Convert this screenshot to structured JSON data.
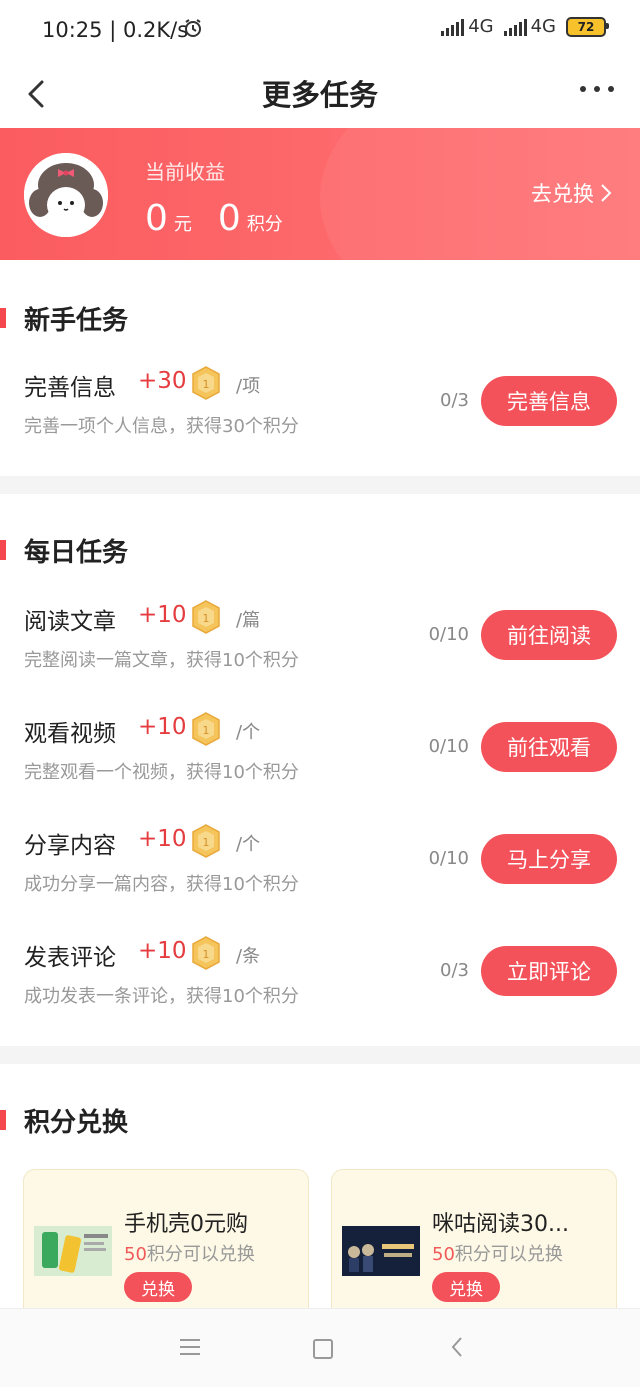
{
  "status_bar": {
    "time": "10:25",
    "speed": "| 0.2K/s",
    "network1": "4G",
    "network2": "4G",
    "battery": "72"
  },
  "header": {
    "title": "更多任务"
  },
  "earnings": {
    "label": "当前收益",
    "yuan_value": "0",
    "yuan_unit": "元",
    "points_value": "0",
    "points_unit": "积分",
    "exchange_link": "去兑换"
  },
  "newbie": {
    "title": "新手任务",
    "tasks": [
      {
        "name": "完善信息",
        "points": "+30",
        "unit": "/项",
        "desc": "完善一项个人信息，获得30个积分",
        "progress": "0/3",
        "button": "完善信息"
      }
    ]
  },
  "daily": {
    "title": "每日任务",
    "tasks": [
      {
        "name": "阅读文章",
        "points": "+10",
        "unit": "/篇",
        "desc": "完整阅读一篇文章，获得10个积分",
        "progress": "0/10",
        "button": "前往阅读"
      },
      {
        "name": "观看视频",
        "points": "+10",
        "unit": "/个",
        "desc": "完整观看一个视频，获得10个积分",
        "progress": "0/10",
        "button": "前往观看"
      },
      {
        "name": "分享内容",
        "points": "+10",
        "unit": "/个",
        "desc": "成功分享一篇内容，获得10个积分",
        "progress": "0/10",
        "button": "马上分享"
      },
      {
        "name": "发表评论",
        "points": "+10",
        "unit": "/条",
        "desc": "成功发表一条评论，获得10个积分",
        "progress": "0/3",
        "button": "立即评论"
      }
    ]
  },
  "exchange": {
    "title": "积分兑换",
    "items": [
      {
        "title": "手机壳0元购",
        "points": "50",
        "sub_suffix": "积分可以兑换",
        "button": "兑换"
      },
      {
        "title": "咪咕阅读30...",
        "points": "50",
        "sub_suffix": "积分可以兑换",
        "button": "兑换"
      }
    ]
  },
  "colors": {
    "accent": "#f4525a",
    "points_red": "#e53c40",
    "coin": "#f2b94a"
  }
}
